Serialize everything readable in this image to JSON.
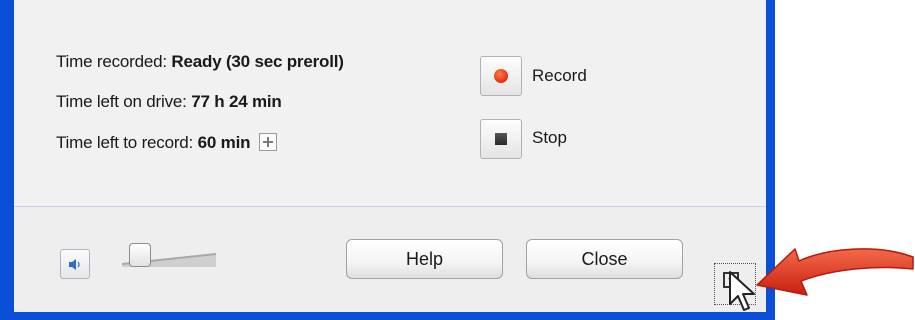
{
  "status": {
    "time_recorded_label": "Time recorded:",
    "time_recorded_value": "Ready (30 sec preroll)",
    "time_left_drive_label": "Time left on drive:",
    "time_left_drive_value": "77 h 24 min",
    "time_left_record_label": "Time left to record:",
    "time_left_record_value": "60 min"
  },
  "controls": {
    "record_label": "Record",
    "stop_label": "Stop",
    "record_icon": "record-dot-icon",
    "stop_icon": "stop-square-icon",
    "add_time_icon": "plus-icon"
  },
  "footer": {
    "help_label": "Help",
    "close_label": "Close",
    "volume_icon": "speaker-icon",
    "volume_level": 0.1
  },
  "colors": {
    "window_frame": "#0b4fd9",
    "record_red": "#e2300a",
    "annotation_arrow": "#e0321b"
  }
}
